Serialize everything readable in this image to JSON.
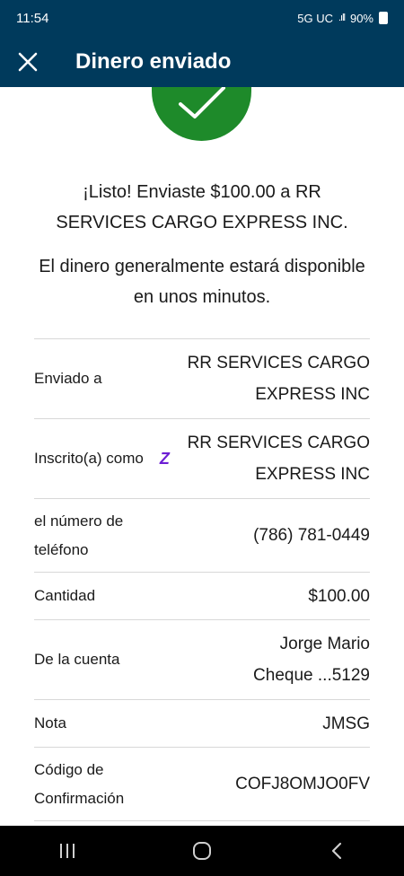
{
  "status_bar": {
    "time": "11:54",
    "network": "5G UC",
    "signal": ".ıll",
    "battery": "90%"
  },
  "app_bar": {
    "close_icon": "close-icon",
    "title": "Dinero enviado"
  },
  "success": {
    "icon": "checkmark-icon",
    "color": "#1e8a2a",
    "message": "¡Listo! Enviaste $100.00 a RR SERVICES CARGO EXPRESS INC.",
    "availability": "El dinero generalmente estará disponible en unos minutos."
  },
  "details": [
    {
      "label": "Enviado a",
      "value": "RR SERVICES CARGO EXPRESS INC"
    },
    {
      "label": "Inscrito(a) como",
      "value": "RR SERVICES CARGO EXPRESS INC",
      "icon": "zelle-icon"
    },
    {
      "label": "el número de teléfono",
      "value": "(786) 781-0449"
    },
    {
      "label": "Cantidad",
      "value": "$100.00"
    },
    {
      "label": "De la cuenta",
      "value": "Jorge Mario Cheque ...5129"
    },
    {
      "label": "Nota",
      "value": "JMSG"
    },
    {
      "label": "Código de Confirmación",
      "value": "COFJ8OMJO0FV"
    }
  ],
  "colors": {
    "header": "#003a5c",
    "zelle": "#6d1ed4"
  },
  "nav_bar": {
    "recents": "recents-icon",
    "home": "home-icon",
    "back": "back-icon"
  }
}
